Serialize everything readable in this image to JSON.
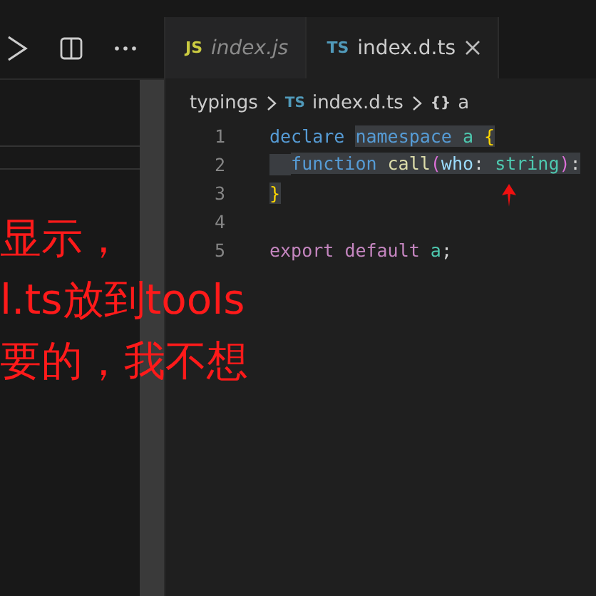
{
  "tabs": [
    {
      "label": "index.js",
      "badge": "JS",
      "selected": false
    },
    {
      "label": "index.d.ts",
      "badge": "TS",
      "selected": true
    }
  ],
  "breadcrumb": [
    {
      "label": "typings"
    },
    {
      "badge": "TS",
      "label": "index.d.ts"
    },
    {
      "badge": "{}",
      "label": "a"
    }
  ],
  "code_lines": [
    {
      "number": "1",
      "tokens": [
        {
          "text": "declare ",
          "kind": "keyword",
          "selected": false
        },
        {
          "text": "namespace ",
          "kind": "keyword",
          "selected": true
        },
        {
          "text": "a ",
          "kind": "type",
          "selected": true
        },
        {
          "text": "{",
          "kind": "brace",
          "selected": true
        }
      ]
    },
    {
      "number": "2",
      "indented": true,
      "tokens": [
        {
          "text": "function ",
          "kind": "keyword",
          "selected": true
        },
        {
          "text": "call",
          "kind": "func",
          "selected": true
        },
        {
          "text": "(",
          "kind": "paren",
          "selected": true
        },
        {
          "text": "who",
          "kind": "param",
          "selected": true
        },
        {
          "text": ": ",
          "kind": "plain",
          "selected": true
        },
        {
          "text": "string",
          "kind": "type",
          "selected": true
        },
        {
          "text": ")",
          "kind": "paren",
          "selected": true
        },
        {
          "text": ":",
          "kind": "plain",
          "selected": true
        }
      ]
    },
    {
      "number": "3",
      "tokens": [
        {
          "text": "}",
          "kind": "brace",
          "selected": true
        }
      ]
    },
    {
      "number": "4"
    },
    {
      "number": "5",
      "tokens": [
        {
          "text": "export ",
          "kind": "control",
          "selected": false
        },
        {
          "text": "default ",
          "kind": "control",
          "selected": false
        },
        {
          "text": "a",
          "kind": "type",
          "selected": false
        },
        {
          "text": ";",
          "kind": "plain",
          "selected": false
        }
      ]
    }
  ],
  "annotation": [
    "显示，",
    "l.ts放到tools",
    "要的，我不想"
  ]
}
